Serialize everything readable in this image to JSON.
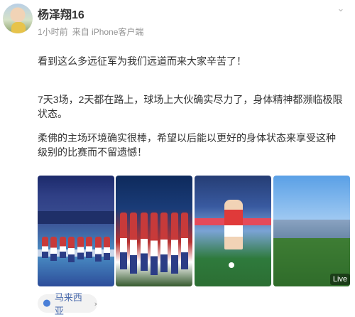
{
  "post": {
    "username": "杨泽翔16",
    "time": "1小时前",
    "source": "来自 iPhone客户端",
    "paragraphs": [
      "看到这么多远征军为我们远道而来大家辛苦了！",
      "7天3场，2天都在路上，球场上大伙确实尽力了，身体精神都濒临极限状态。",
      "柔佛的主场环境确实很棒，希望以后能以更好的身体状态来享受这种级别的比赛而不留遗憾！"
    ],
    "live_badge": "Live",
    "location": "马来西亚"
  },
  "icons": {
    "more": "chevron-down-icon",
    "location": "location-pin-icon",
    "location_arrow": "chevron-right-icon",
    "verified": "verified-badge-icon"
  },
  "colors": {
    "username": "#333333",
    "meta": "#939393",
    "location_text": "#4b6cae",
    "location_icon": "#4a7fd8"
  }
}
